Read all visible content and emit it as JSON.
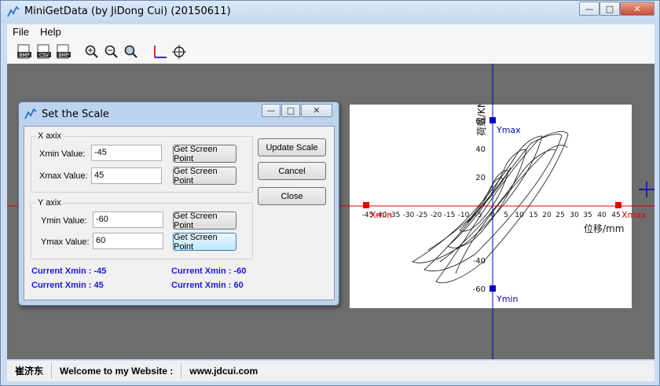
{
  "window": {
    "title": "MiniGetData (by JiDong Cui) (20150611)",
    "controls": {
      "minimize": "—",
      "maximize": "□",
      "close": "✕"
    }
  },
  "menu": {
    "items": [
      "File",
      "Help"
    ]
  },
  "toolbar": {
    "buttons": [
      {
        "name": "open-bmp",
        "label": "BMP"
      },
      {
        "name": "save-csv",
        "label": "CSV"
      },
      {
        "name": "save-bmp",
        "label": "BMP"
      }
    ]
  },
  "dialog": {
    "title": "Set the Scale",
    "x_axis": {
      "title": "X axix",
      "min_label": "Xmin Value:",
      "min_value": "-45",
      "max_label": "Xmax Value:",
      "max_value": "45"
    },
    "y_axis": {
      "title": "Y axix",
      "min_label": "Ymin Value:",
      "min_value": "-60",
      "max_label": "Ymax Value:",
      "max_value": "60"
    },
    "get_point_label": "Get Screen Point",
    "update_label": "Update Scale",
    "cancel_label": "Cancel",
    "close_label": "Close",
    "current": {
      "xmin": "Current Xmin : -45",
      "xmax": "Current Xmin : 45",
      "ymin": "Current Xmin : -60",
      "ymax": "Current Xmin : 60"
    }
  },
  "plot": {
    "ylabel": "荷载/KN",
    "xlabel": "位移/mm",
    "y_ticks": [
      "60",
      "40",
      "20",
      "-40",
      "-60"
    ],
    "x_ticks": [
      "-45",
      "-40",
      "-35",
      "-30",
      "-25",
      "-20",
      "-15",
      "-10",
      "-5",
      "0",
      "5",
      "10",
      "15",
      "20",
      "25",
      "30",
      "35",
      "40",
      "45"
    ],
    "markers": {
      "xmin": "Xmin",
      "xmax": "Xmax",
      "ymin": "Ymin",
      "ymax": "Ymax"
    },
    "colors": {
      "x_calib": "#e00000",
      "y_calib": "#0000c8"
    }
  },
  "status": {
    "author": "崔济东",
    "welcome": "Welcome to my Website :",
    "url": "www.jdcui.com"
  }
}
